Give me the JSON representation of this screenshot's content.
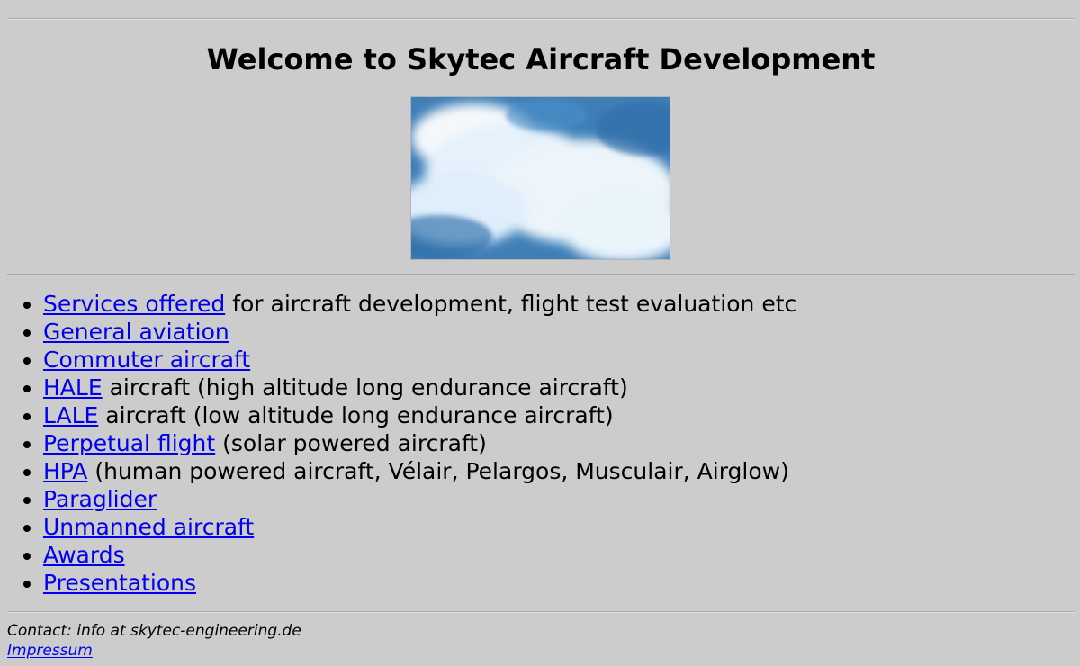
{
  "page": {
    "title": "Welcome to Skytec Aircraft Development"
  },
  "hero": {
    "image_name": "clouds-photo"
  },
  "links": [
    {
      "link_text": "Services offered",
      "tail": " for aircraft development, flight test evaluation etc"
    },
    {
      "link_text": "General aviation",
      "tail": ""
    },
    {
      "link_text": "Commuter aircraft",
      "tail": ""
    },
    {
      "link_text": "HALE",
      "tail": " aircraft (high altitude long endurance aircraft)"
    },
    {
      "link_text": "LALE",
      "tail": " aircraft (low altitude long endurance aircraft)"
    },
    {
      "link_text": "Perpetual flight",
      "tail": " (solar powered aircraft)"
    },
    {
      "link_text": "HPA",
      "tail": " (human powered aircraft, Vélair, Pelargos, Musculair, Airglow)"
    },
    {
      "link_text": "Paraglider",
      "tail": ""
    },
    {
      "link_text": "Unmanned aircraft",
      "tail": ""
    },
    {
      "link_text": "Awards",
      "tail": ""
    },
    {
      "link_text": "Presentations",
      "tail": ""
    }
  ],
  "footer": {
    "contact_text": "Contact: info at skytec-engineering.de",
    "impressum_link": "Impressum"
  },
  "colors": {
    "background": "#cccccc",
    "link": "#0000ee",
    "text": "#000000"
  }
}
